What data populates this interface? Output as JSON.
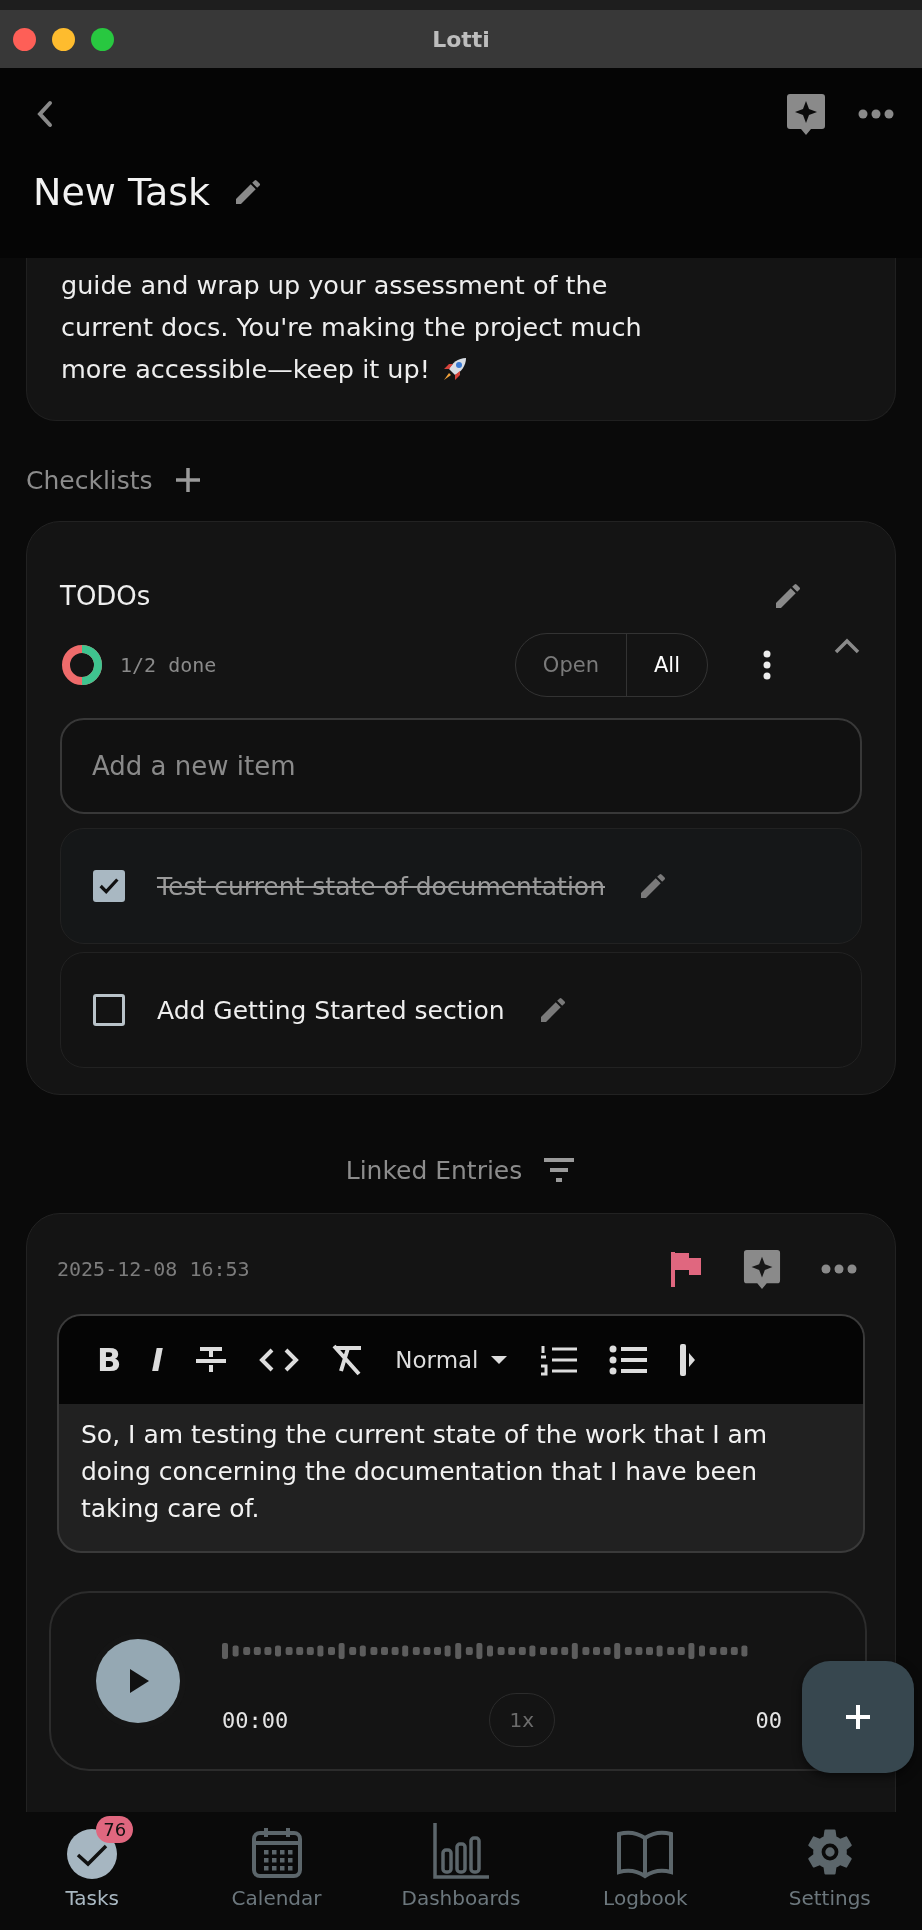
{
  "window": {
    "title": "Lotti"
  },
  "header": {
    "title": "New Task"
  },
  "summary": {
    "lines": [
      "guide and wrap up your assessment of the",
      "current docs. You're making the project much",
      "more accessible—keep it up!"
    ]
  },
  "checklists": {
    "label": "Checklists",
    "lists": [
      {
        "title": "TODOs",
        "expanded": true,
        "progress": {
          "level": 0.5,
          "text": "1/2 done"
        },
        "filters": [
          {
            "label": "Open",
            "selected": false
          },
          {
            "label": "All",
            "selected": true
          }
        ],
        "new_item": {
          "placeholder": "Add a new item"
        },
        "items": [
          {
            "text": "Test current state of documentation",
            "checked": true
          },
          {
            "text": "Add Getting Started section",
            "checked": false
          }
        ]
      }
    ]
  },
  "linked_entries": {
    "label": "Linked Entries",
    "entries": [
      {
        "date": "2025-12-08 16:53",
        "flagged": true,
        "toolbar": {
          "bold": "B",
          "italic": "I",
          "style": "Normal"
        },
        "text": "So, I am testing the current state of the work that I am doing concerning the documentation that I have been taking care of.",
        "audio": {
          "position": "00:00",
          "speed": "1x",
          "duration": "00"
        }
      }
    ]
  },
  "nav": [
    {
      "label": "Tasks",
      "selected": true,
      "badge": "76"
    },
    {
      "label": "Calendar",
      "selected": false
    },
    {
      "label": "Dashboards",
      "selected": false
    },
    {
      "label": "Logbook",
      "selected": false
    },
    {
      "label": "Settings",
      "selected": false
    }
  ]
}
